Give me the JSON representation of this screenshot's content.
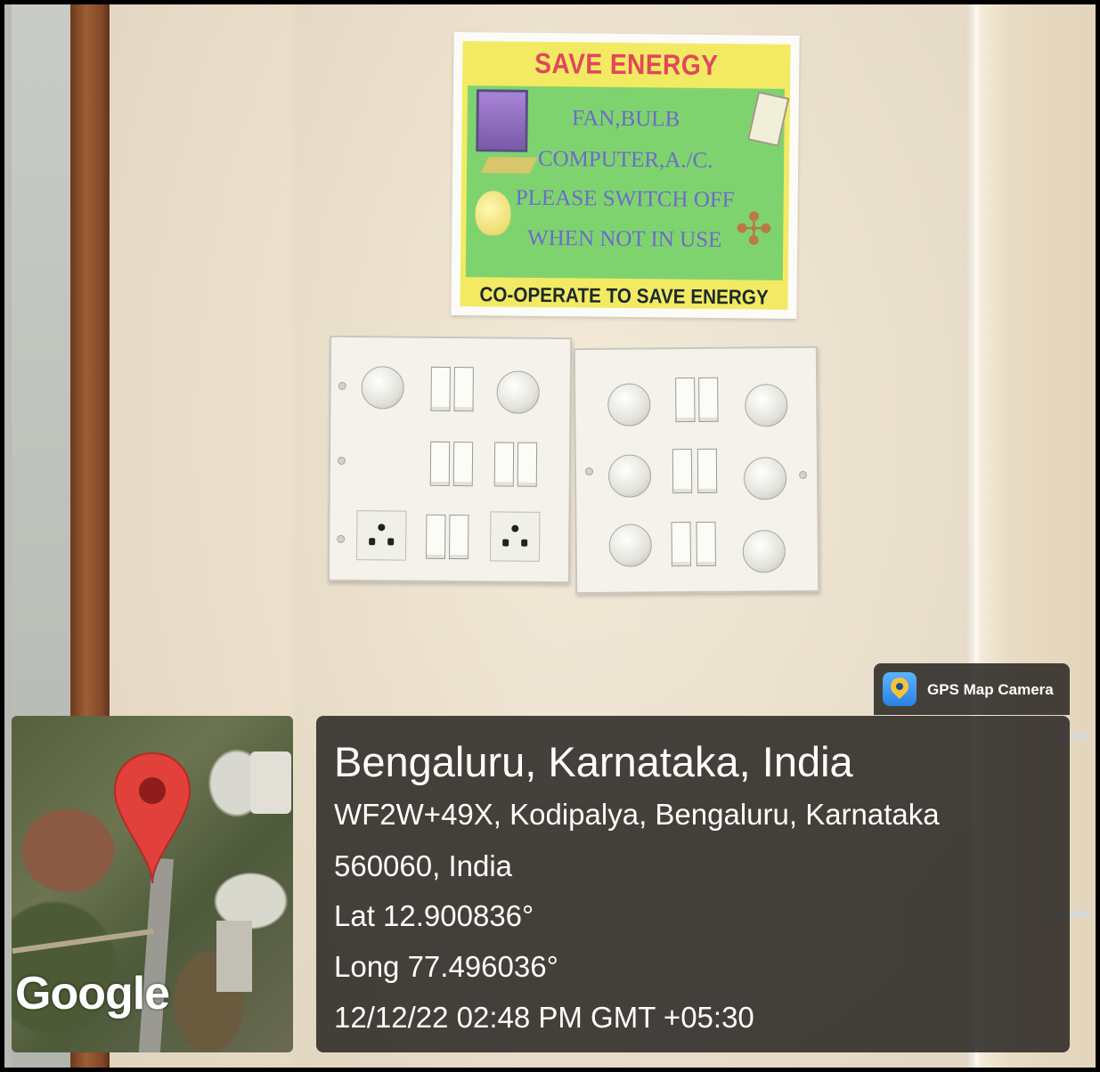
{
  "sign": {
    "title": "SAVE ENERGY",
    "lines": [
      "FAN,BULB",
      "COMPUTER,A./C.",
      "PLEASE SWITCH OFF",
      "WHEN NOT IN USE"
    ],
    "footer": "CO-OPERATE TO SAVE ENERGY"
  },
  "badge": {
    "label": "GPS Map Camera",
    "icon": "gps-map-camera-icon"
  },
  "map": {
    "attribution": "Google",
    "icon": "location-pin-icon"
  },
  "location": {
    "place": "Bengaluru, Karnataka, India",
    "address_line1": "WF2W+49X, Kodipalya, Bengaluru, Karnataka",
    "address_line2": "560060, India",
    "lat": "Lat 12.900836°",
    "long": "Long 77.496036°",
    "datetime": "12/12/22 02:48 PM GMT +05:30"
  },
  "colors": {
    "sign_title": "#e0485a",
    "sign_green": "#7fd36f",
    "sign_yellow": "#f3ea63",
    "pin_red": "#e2403a",
    "overlay": "#282522"
  }
}
